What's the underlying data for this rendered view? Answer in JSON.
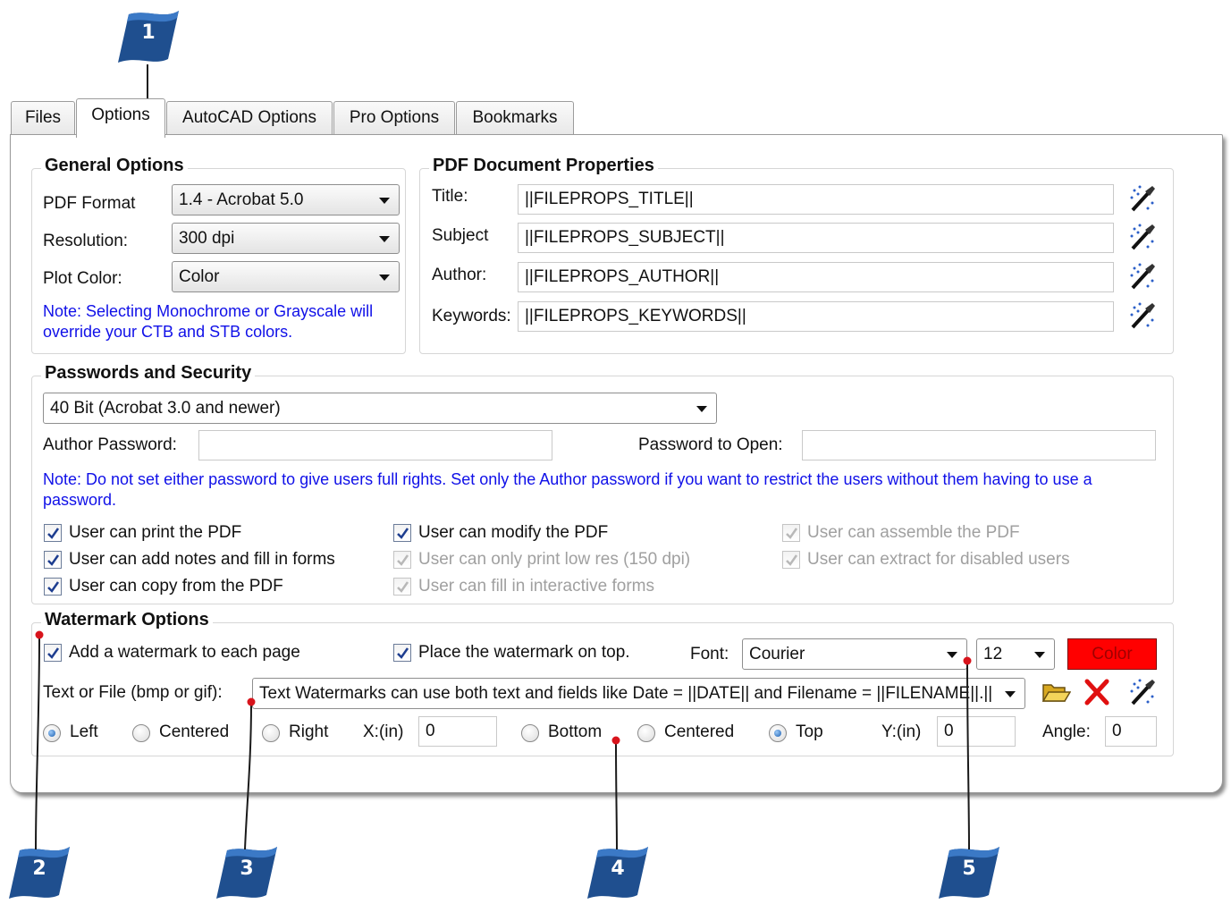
{
  "callouts": [
    "1",
    "2",
    "3",
    "4",
    "5"
  ],
  "tabs": [
    "Files",
    "Options",
    "AutoCAD Options",
    "Pro Options",
    "Bookmarks"
  ],
  "active_tab": "Options",
  "general": {
    "title": "General Options",
    "pdf_format_label": "PDF Format",
    "pdf_format_value": "1.4 - Acrobat 5.0",
    "resolution_label": "Resolution:",
    "resolution_value": "300 dpi",
    "plot_color_label": "Plot Color:",
    "plot_color_value": "Color",
    "note": "Note:  Selecting Monochrome or Grayscale will override your CTB and STB colors."
  },
  "doc_props": {
    "title": "PDF Document Properties",
    "fields": [
      {
        "label": "Title:",
        "value": "||FILEPROPS_TITLE||"
      },
      {
        "label": "Subject",
        "value": "||FILEPROPS_SUBJECT||"
      },
      {
        "label": "Author:",
        "value": "||FILEPROPS_AUTHOR||"
      },
      {
        "label": "Keywords:",
        "value": "||FILEPROPS_KEYWORDS||"
      }
    ]
  },
  "security": {
    "title": "Passwords and Security",
    "encryption_value": "40 Bit (Acrobat 3.0 and newer)",
    "author_password_label": "Author Password:",
    "author_password_value": "",
    "open_password_label": "Password to Open:",
    "open_password_value": "",
    "note": "Note:  Do not set either password to give users full rights.  Set only the Author password if you want to restrict the users without them having to use a password.",
    "permissions": [
      {
        "label": "User can print the PDF",
        "checked": true,
        "enabled": true
      },
      {
        "label": "User can add notes and fill in forms",
        "checked": true,
        "enabled": true
      },
      {
        "label": "User can copy from the PDF",
        "checked": true,
        "enabled": true
      },
      {
        "label": "User can modify the PDF",
        "checked": true,
        "enabled": true
      },
      {
        "label": "User can only print low res (150 dpi)",
        "checked": true,
        "enabled": false
      },
      {
        "label": "User can fill in interactive forms",
        "checked": true,
        "enabled": false
      },
      {
        "label": "User can assemble the PDF",
        "checked": true,
        "enabled": false
      },
      {
        "label": "User can extract for disabled users",
        "checked": true,
        "enabled": false
      }
    ]
  },
  "watermark": {
    "title": "Watermark Options",
    "add_each_page_label": "Add a watermark to each page",
    "add_each_page_checked": true,
    "on_top_label": "Place the watermark on top.",
    "on_top_checked": true,
    "font_label": "Font:",
    "font_value": "Courier",
    "size_value": "12",
    "color_label": "Color",
    "color_hex": "#ff0000",
    "text_label": "Text or File (bmp or gif):",
    "text_value": "Text Watermarks can use both text and fields like Date = ||DATE|| and Filename = ||FILENAME||.||",
    "horizontal": [
      "Left",
      "Centered",
      "Right"
    ],
    "horizontal_selected": "Left",
    "x_label": "X:(in)",
    "x_value": "0",
    "vertical": [
      "Bottom",
      "Centered",
      "Top"
    ],
    "vertical_selected": "Top",
    "y_label": "Y:(in)",
    "y_value": "0",
    "angle_label": "Angle:",
    "angle_value": "0"
  },
  "icons": {
    "field_picker": "wand-icon",
    "browse": "open-folder-icon",
    "clear": "red-x-icon"
  }
}
